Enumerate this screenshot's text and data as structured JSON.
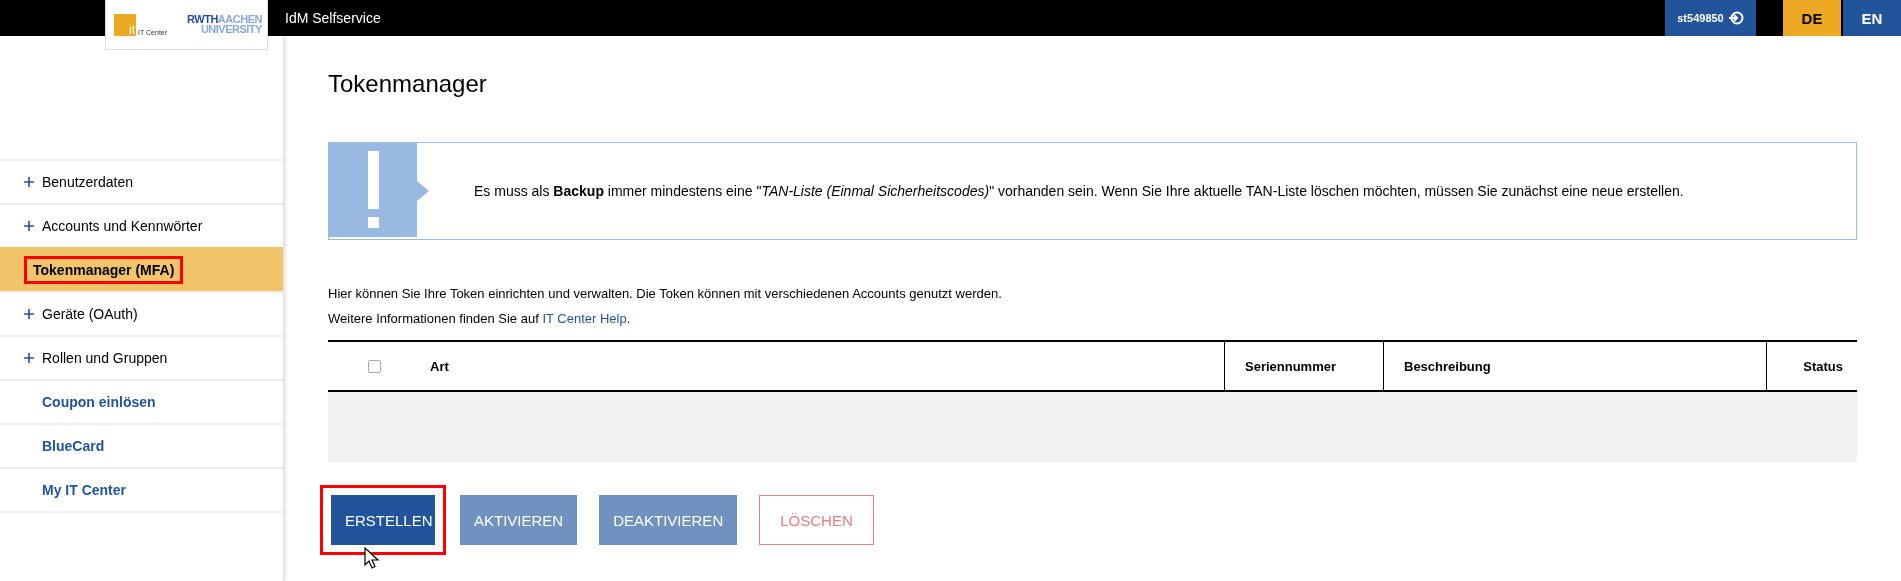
{
  "header": {
    "logo": {
      "it_caption": "IT Center",
      "it_mark": "it",
      "uni_top": "RWTH",
      "uni_top2": "AACHEN",
      "uni_bottom": "UNIVERSITY"
    },
    "title": "IdM Selfservice",
    "user": "st549850",
    "languages": [
      {
        "label": "DE",
        "selected": true
      },
      {
        "label": "EN",
        "selected": false
      }
    ]
  },
  "sidebar": {
    "items": [
      {
        "label": "Benutzerdaten",
        "kind": "group",
        "selected": false,
        "highlighted": false
      },
      {
        "label": "Accounts und Kennwörter",
        "kind": "group",
        "selected": false,
        "highlighted": false
      },
      {
        "label": "Tokenmanager (MFA)",
        "kind": "page",
        "selected": true,
        "highlighted": true
      },
      {
        "label": "Geräte (OAuth)",
        "kind": "group",
        "selected": false,
        "highlighted": false
      },
      {
        "label": "Rollen und Gruppen",
        "kind": "group",
        "selected": false,
        "highlighted": false
      },
      {
        "label": "Coupon einlösen",
        "kind": "link",
        "selected": false,
        "highlighted": false
      },
      {
        "label": "BlueCard",
        "kind": "link",
        "selected": false,
        "highlighted": false
      },
      {
        "label": "My IT Center",
        "kind": "link",
        "selected": false,
        "highlighted": false
      }
    ]
  },
  "main": {
    "title": "Tokenmanager",
    "alert": {
      "text": "Es muss als **Backup** immer mindestens eine \"*TAN-Liste (Einmal Sicherheitscodes)*\" vorhanden sein. Wenn Sie Ihre aktuelle TAN-Liste löschen möchten, müssen Sie zunächst eine neue erstellen."
    },
    "intro": "Hier können Sie Ihre Token einrichten und verwalten. Die Token können mit verschiedenen Accounts genutzt werden.",
    "info": {
      "text": "Weitere Informationen finden Sie auf ",
      "link": "IT Center Help",
      "after": "."
    },
    "table": {
      "select_all": {
        "checked": false
      },
      "columns": [
        "Art",
        "Seriennummer",
        "Beschreibung",
        "Status"
      ]
    },
    "buttons": [
      {
        "label": "ERSTELLEN",
        "kind": "primary",
        "highlighted": true,
        "hovered": true
      },
      {
        "label": "AKTIVIEREN",
        "kind": "secondary",
        "highlighted": false,
        "hovered": false
      },
      {
        "label": "DEAKTIVIEREN",
        "kind": "secondary",
        "highlighted": false,
        "hovered": false
      },
      {
        "label": "LÖSCHEN",
        "kind": "danger",
        "highlighted": false,
        "hovered": false
      }
    ]
  }
}
